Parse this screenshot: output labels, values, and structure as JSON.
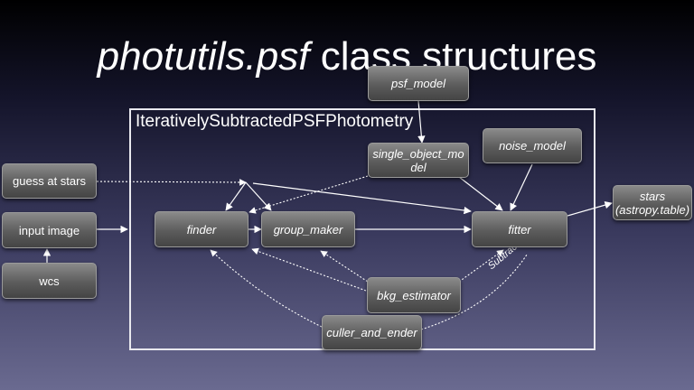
{
  "title": {
    "module": "photutils.psf",
    "rest": " class structures"
  },
  "container": {
    "label": "IterativelySubtractedPSFPhotometry"
  },
  "nodes": {
    "psf_model": "psf_model",
    "single_object_model": "single_object_mo del",
    "noise_model": "noise_model",
    "guess_at_stars": "guess at stars",
    "input_image": "input image",
    "wcs": "wcs",
    "finder": "finder",
    "group_maker": "group_maker",
    "fitter": "fitter",
    "stars": "stars (astropy.table)",
    "bkg_estimator": "bkg_estimator",
    "culler_and_ender": "culler_and_ender"
  },
  "edge_labels": {
    "subtract": "Subtract"
  },
  "colors": {
    "edge": "#ffffff",
    "node_border": "#9a9a9a",
    "frame": "#e8e8ee"
  }
}
